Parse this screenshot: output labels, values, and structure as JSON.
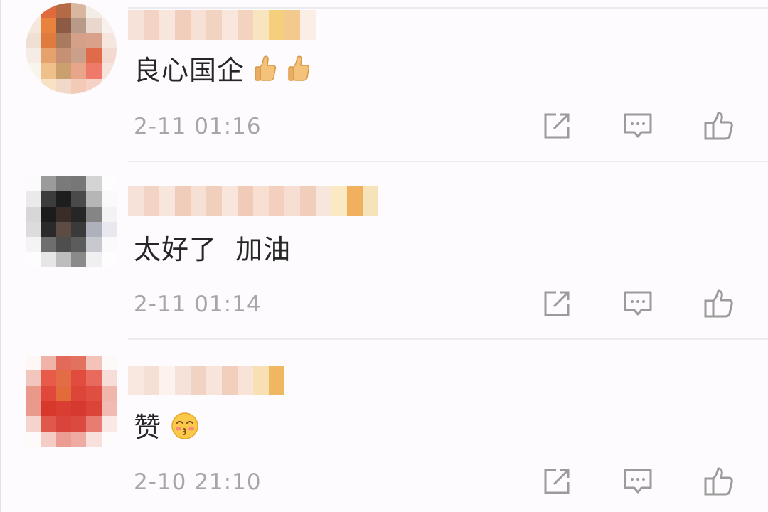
{
  "comments": [
    {
      "text": "良心国企",
      "time": "2-11 01:16",
      "emojis": [
        "thumbs-up-emoji",
        "thumbs-up-emoji"
      ]
    },
    {
      "text": "太好了  加油",
      "time": "2-11 01:14",
      "emojis": []
    },
    {
      "text": "赞",
      "time": "2-10 21:10",
      "emojis": [
        "kissing-face-emoji"
      ]
    }
  ],
  "actions": [
    "repost-icon",
    "comment-icon",
    "like-icon"
  ],
  "colors": {
    "time": "#a6a6a8",
    "icon": "#9b9b9b",
    "divider": "#ebebeb"
  }
}
